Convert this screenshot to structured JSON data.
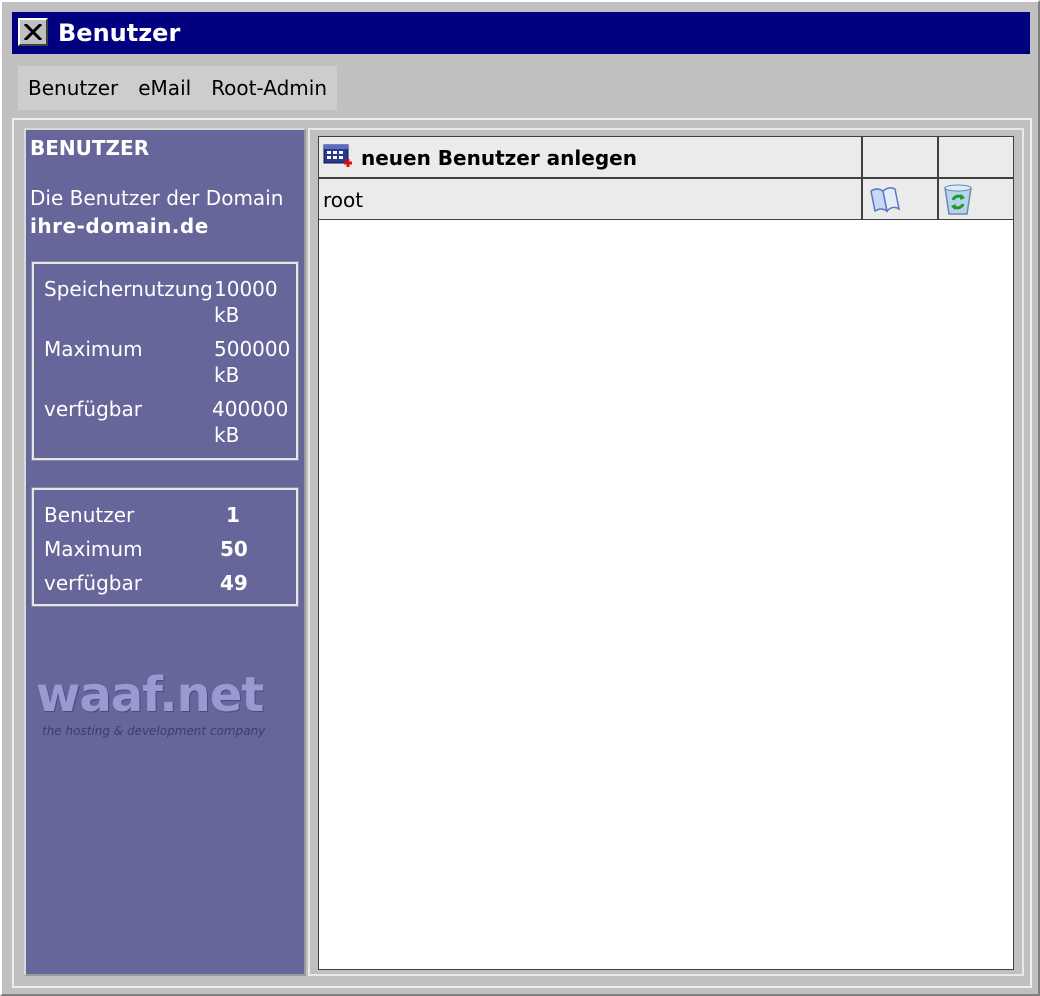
{
  "window": {
    "title": "Benutzer"
  },
  "menu": {
    "items": [
      "Benutzer",
      "eMail",
      "Root-Admin"
    ]
  },
  "sidebar": {
    "heading": "BENUTZER",
    "description": "Die Benutzer der Domain",
    "domain": "ihre-domain.de",
    "storage": {
      "rows": [
        {
          "label": "Speichernutzung",
          "value": "10000",
          "unit": "kB"
        },
        {
          "label": "Maximum",
          "value": "500000",
          "unit": "kB"
        },
        {
          "label": "verfügbar",
          "value": "400000",
          "unit": "kB"
        }
      ]
    },
    "users": {
      "rows": [
        {
          "label": "Benutzer",
          "value": "1"
        },
        {
          "label": "Maximum",
          "value": "50"
        },
        {
          "label": "verfügbar",
          "value": "49"
        }
      ]
    },
    "logo": {
      "name": "waaf.net",
      "tagline": "the hosting & development company"
    }
  },
  "table": {
    "new_user_label": "neuen Benutzer anlegen",
    "rows": [
      {
        "name": "root"
      }
    ]
  },
  "icons": {
    "close": "close-icon",
    "new_user": "add-user-icon",
    "edit": "edit-book-icon",
    "delete": "recycle-bin-icon"
  },
  "colors": {
    "titlebar": "#000080",
    "sidebar": "#66669a",
    "window": "#c0c0c0"
  }
}
